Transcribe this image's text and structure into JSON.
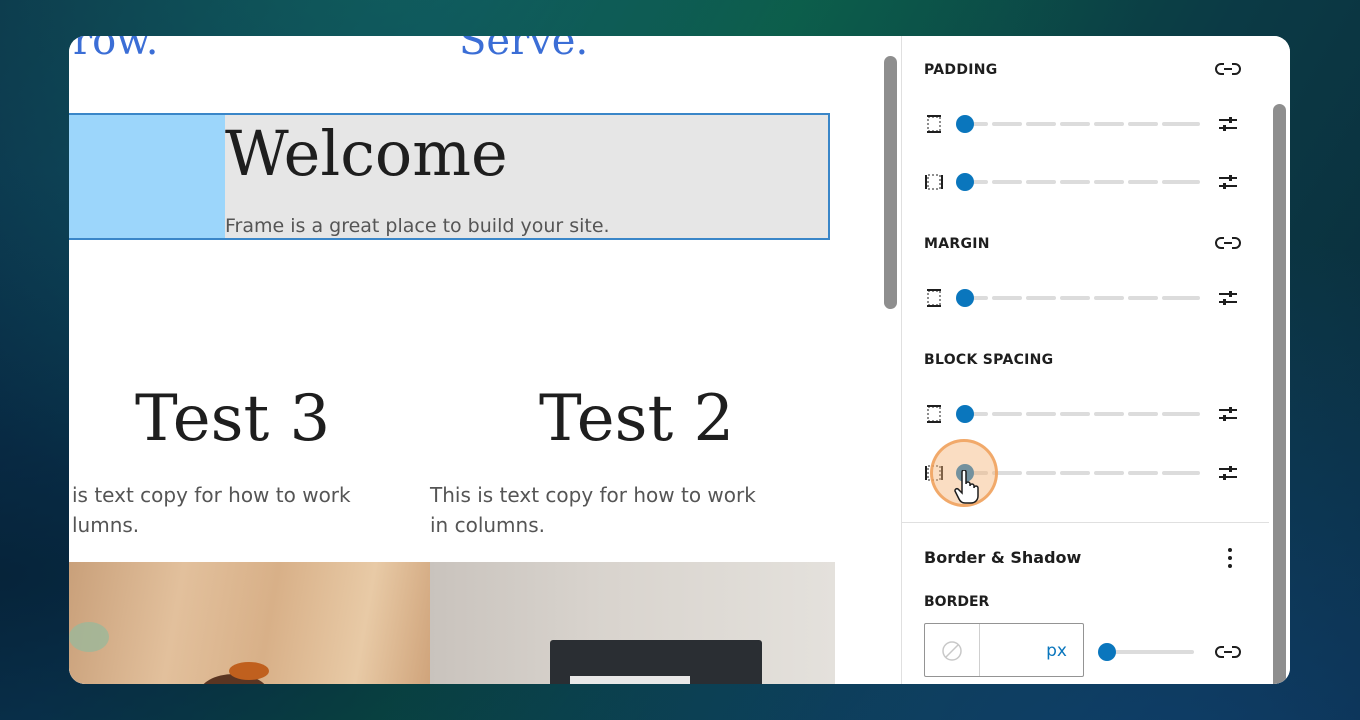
{
  "canvas": {
    "top_words": [
      "row.",
      "Serve."
    ],
    "welcome": {
      "title": "Welcome",
      "subtitle": "Frame is a great place to build your site."
    },
    "columns": [
      {
        "title": "Test 3",
        "text_line1": "is text copy for how to work",
        "text_line2": "lumns."
      },
      {
        "title": "Test 2",
        "text_line1": "This is text copy for how to work",
        "text_line2": "in columns."
      }
    ]
  },
  "panel": {
    "padding_label": "PADDING",
    "margin_label": "MARGIN",
    "block_spacing_label": "BLOCK SPACING",
    "border_shadow_heading": "Border & Shadow",
    "border_label": "BORDER",
    "border_unit": "px",
    "sliders": {
      "padding_vertical": 0,
      "padding_horizontal": 0,
      "margin_vertical": 0,
      "block_spacing_vertical": 0,
      "block_spacing_horizontal": 0,
      "border_width": 0
    },
    "icons": [
      "unlink-icon",
      "side-vertical-icon",
      "side-horizontal-icon",
      "sliders-icon",
      "more-vertical-icon",
      "no-color-icon",
      "hand-cursor-icon"
    ]
  },
  "colors": {
    "accent": "#0a76bd",
    "selection_outline": "#3a86c8",
    "selection_fill": "#9cd6fb",
    "heading_link": "#3b6ed6"
  }
}
